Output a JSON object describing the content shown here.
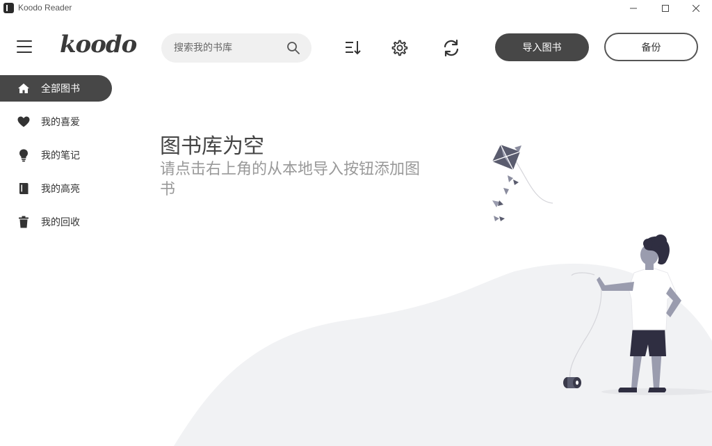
{
  "window": {
    "title": "Koodo Reader",
    "minimize": "—",
    "maximize": "☐",
    "close": "✕"
  },
  "header": {
    "logo": "koodo",
    "search_placeholder": "搜索我的书库",
    "import_label": "导入图书",
    "backup_label": "备份"
  },
  "sidebar": {
    "items": [
      {
        "label": "全部图书",
        "icon": "home-icon",
        "active": true
      },
      {
        "label": "我的喜爱",
        "icon": "heart-icon",
        "active": false
      },
      {
        "label": "我的笔记",
        "icon": "lightbulb-icon",
        "active": false
      },
      {
        "label": "我的高亮",
        "icon": "book-icon",
        "active": false
      },
      {
        "label": "我的回收",
        "icon": "trash-icon",
        "active": false
      }
    ]
  },
  "empty": {
    "title": "图书库为空",
    "description": "请点击右上角的从本地导入按钮添加图书"
  },
  "colors": {
    "accent": "#474747",
    "muted_text": "#999999",
    "search_bg": "#f0f0f0",
    "hill": "#f1f2f4"
  }
}
